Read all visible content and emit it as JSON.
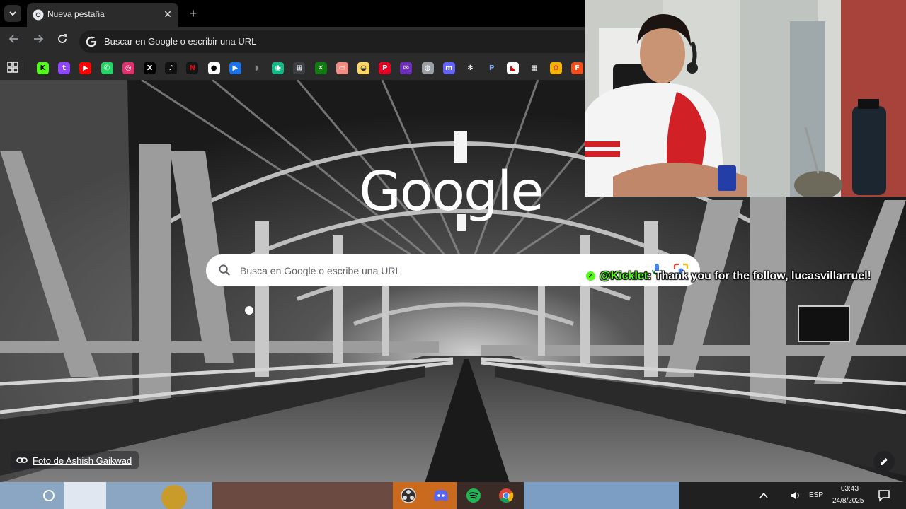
{
  "browser": {
    "tab_title": "Nueva pestaña",
    "new_tab_symbol": "+",
    "close_symbol": "✕",
    "omnibox_text": "Buscar en Google o escribir una URL",
    "bookmarks": [
      {
        "icon": "kick-icon",
        "glyph": "K",
        "color": "#53fc18",
        "fg": "#000"
      },
      {
        "icon": "twitch-icon",
        "glyph": "t",
        "color": "#9146ff",
        "fg": "#fff"
      },
      {
        "icon": "youtube-icon",
        "glyph": "▶",
        "color": "#ff0000",
        "fg": "#fff"
      },
      {
        "icon": "whatsapp-icon",
        "glyph": "✆",
        "color": "#25d366",
        "fg": "#fff"
      },
      {
        "icon": "instagram-icon",
        "glyph": "◎",
        "color": "#e1306c",
        "fg": "#fff"
      },
      {
        "icon": "x-icon",
        "glyph": "X",
        "color": "#000000",
        "fg": "#fff"
      },
      {
        "icon": "tiktok-icon",
        "glyph": "♪",
        "color": "#111111",
        "fg": "#fff"
      },
      {
        "icon": "netflix-icon",
        "glyph": "N",
        "color": "#141414",
        "fg": "#e50914"
      },
      {
        "icon": "record-icon",
        "glyph": "●",
        "color": "#ffffff",
        "fg": "#000"
      },
      {
        "icon": "play-icon",
        "glyph": "▶",
        "color": "#1a73e8",
        "fg": "#fff"
      },
      {
        "icon": "streamer-icon",
        "glyph": "◗",
        "color": "#2b2b2b",
        "fg": "#888"
      },
      {
        "icon": "spotify-like-icon",
        "glyph": "◉",
        "color": "#12b886",
        "fg": "#fff"
      },
      {
        "icon": "calculator-icon",
        "glyph": "⊞",
        "color": "#3c4043",
        "fg": "#fff"
      },
      {
        "icon": "xbox-icon",
        "glyph": "✕",
        "color": "#107c10",
        "fg": "#fff"
      },
      {
        "icon": "tv-icon",
        "glyph": "▭",
        "color": "#f28b82",
        "fg": "#fff"
      },
      {
        "icon": "pill-icon",
        "glyph": "◒",
        "color": "#fdd663",
        "fg": "#333"
      },
      {
        "icon": "pinterest-icon",
        "glyph": "P",
        "color": "#e60023",
        "fg": "#fff"
      },
      {
        "icon": "mail-icon",
        "glyph": "✉",
        "color": "#6f2dbd",
        "fg": "#fff"
      },
      {
        "icon": "globe-icon",
        "glyph": "◍",
        "color": "#9aa0a6",
        "fg": "#fff"
      },
      {
        "icon": "mastodon-icon",
        "glyph": "m",
        "color": "#6364ff",
        "fg": "#fff"
      },
      {
        "icon": "openai-icon",
        "glyph": "✻",
        "color": "#2b2b2b",
        "fg": "#fff"
      },
      {
        "icon": "paypal-icon",
        "glyph": "P",
        "color": "#2b2b2b",
        "fg": "#8ab4f8"
      },
      {
        "icon": "river-plate-icon",
        "glyph": "◣",
        "color": "#ffffff",
        "fg": "#d00"
      },
      {
        "icon": "bbc-icon",
        "glyph": "▦",
        "color": "#2b2b2b",
        "fg": "#fff"
      },
      {
        "icon": "colorful-app-icon",
        "glyph": "✿",
        "color": "#f4b400",
        "fg": "#db4437"
      },
      {
        "icon": "figma-icon",
        "glyph": "F",
        "color": "#f24e1e",
        "fg": "#fff"
      }
    ]
  },
  "newtab": {
    "logo": "Google",
    "search_placeholder": "Busca en Google o escribe una URL",
    "photo_credit": "Foto de Ashish Gaikwad"
  },
  "overlay": {
    "username": "@Kicklet",
    "message": ": Thank you for the follow, lucasvillarruel!"
  },
  "taskbar": {
    "language": "ESP",
    "time": "03:43",
    "date": "24/8/2025",
    "apps": [
      "obs-icon",
      "discord-icon",
      "spotify-icon",
      "chrome-icon"
    ]
  }
}
